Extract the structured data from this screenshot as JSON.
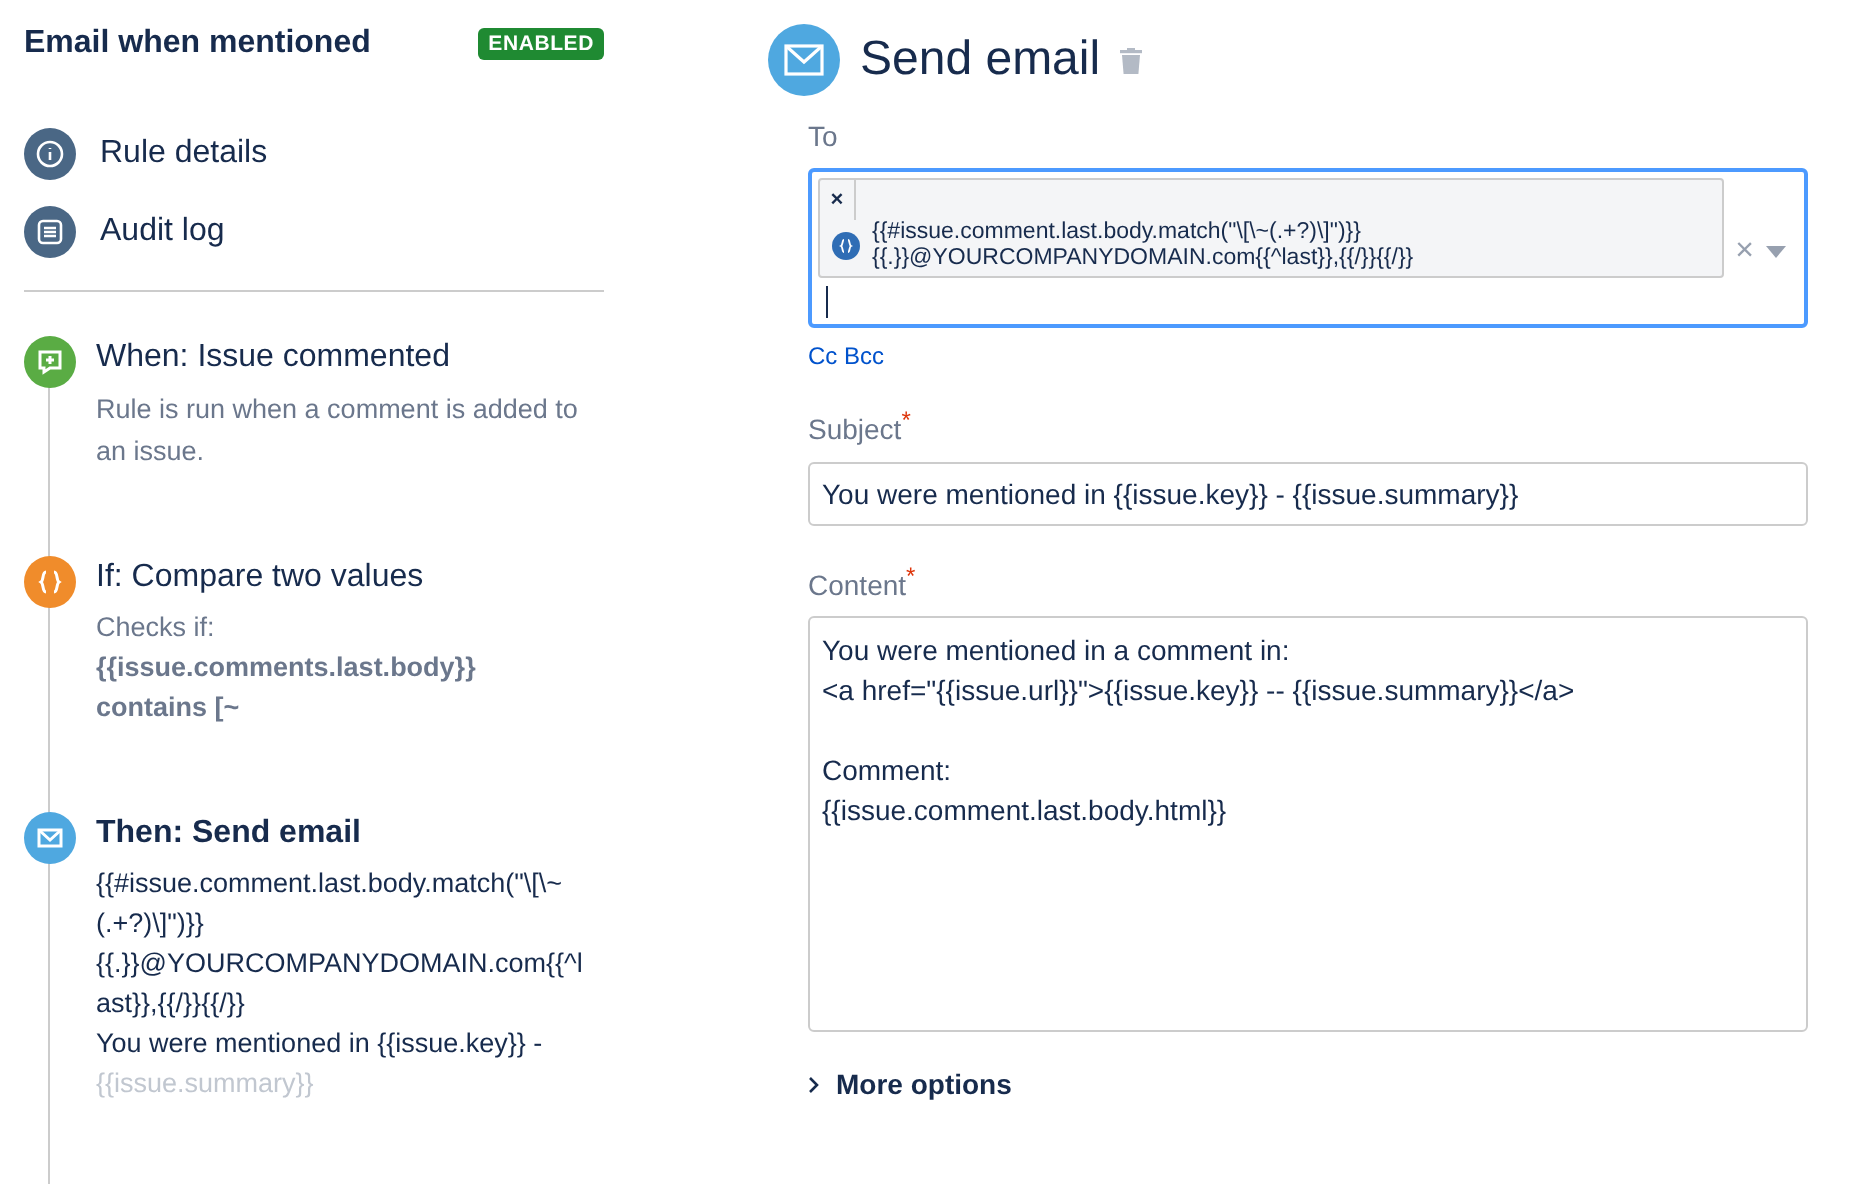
{
  "rule": {
    "title": "Email when mentioned",
    "status": "ENABLED",
    "enabled": true
  },
  "nav": [
    {
      "kind": "info",
      "label": "Rule details"
    },
    {
      "kind": "list",
      "label": "Audit log"
    }
  ],
  "steps": [
    {
      "kind": "trigger",
      "title": "When: Issue commented",
      "selected": false,
      "lines": [
        {
          "kind": "description",
          "text": "Rule is run when a comment is added to an issue."
        }
      ]
    },
    {
      "kind": "condition",
      "title": "If: Compare two values",
      "selected": false,
      "lines": [
        {
          "kind": "muted",
          "text": "Checks if:"
        },
        {
          "kind": "strong",
          "text": "{{issue.comments.last.body}}"
        },
        {
          "kind": "strong",
          "text": "contains [~"
        }
      ]
    },
    {
      "kind": "action",
      "title": "Then: Send email",
      "selected": true,
      "lines": [
        {
          "kind": "plain",
          "text": "{{#issue.comment.last.body.match(\"\\[\\~"
        },
        {
          "kind": "plain",
          "text": "(.+?)\\]\")}}"
        },
        {
          "kind": "plain",
          "text": "{{.}}@YOURCOMPANYDOMAIN.com{{^l"
        },
        {
          "kind": "plain",
          "text": "ast}},{{/}}{{/}}"
        },
        {
          "kind": "plain",
          "text": "You were mentioned in {{issue.key}} -"
        },
        {
          "kind": "faded",
          "text": "{{issue.summary}}"
        }
      ]
    }
  ],
  "editor": {
    "title": "Send email",
    "to": {
      "label": "To",
      "focused": true,
      "chip": {
        "remove": "×",
        "lines": [
          "{{#issue.comment.last.body.match(\"\\[\\~(.+?)\\]\")}}",
          "{{.}}@YOURCOMPANYDOMAIN.com{{^last}},{{/}}{{/}}"
        ]
      },
      "clear": "×"
    },
    "cc_bcc": "Cc Bcc",
    "subject": {
      "label": "Subject",
      "required_mark": "*",
      "value": "You were mentioned in {{issue.key}} - {{issue.summary}}"
    },
    "content": {
      "label": "Content",
      "required_mark": "*",
      "value": "You were mentioned in a comment in:\n<a href=\"{{issue.url}}\">{{issue.key}} -- {{issue.summary}}</a>\n\nComment:\n{{issue.comment.last.body.html}}"
    },
    "more_options": {
      "label": "More options",
      "expanded": false
    }
  }
}
